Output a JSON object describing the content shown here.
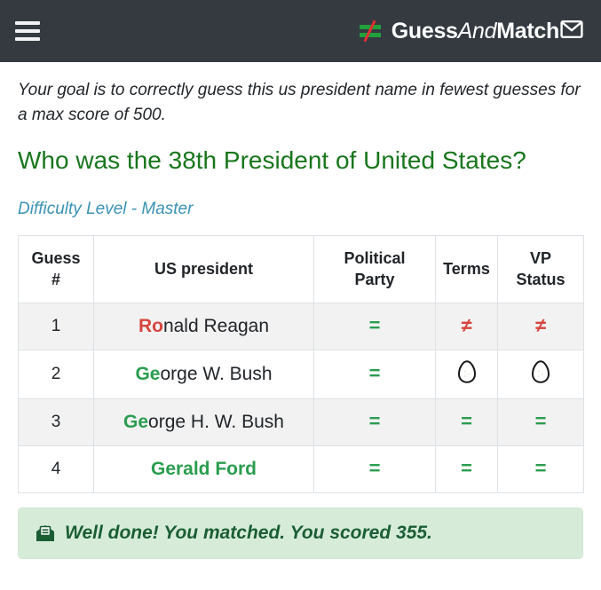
{
  "navbar": {
    "menu_icon": "hamburger-icon",
    "brand": {
      "logo_icon": "not-equals-logo-icon",
      "part1": "Guess",
      "part2": "And",
      "part3": "Match",
      "mail_icon": "envelope-icon"
    }
  },
  "intro": {
    "goal": "Your goal is to correctly guess this us president name in fewest guesses for a max score of 500.",
    "question": "Who was the 38th President of United States?",
    "difficulty": "Difficulty Level - Master"
  },
  "table": {
    "headers": {
      "guess": "Guess #",
      "guess_line1": "Guess",
      "guess_line2": "#",
      "president": "US president",
      "party_line1": "Political",
      "party_line2": "Party",
      "terms": "Terms",
      "vp_line1": "VP",
      "vp_line2": "Status"
    },
    "rows": [
      {
        "guess_no": "1",
        "name_hint": "Ro",
        "name_rest": "nald Reagan",
        "hint_state": "red",
        "party": "=",
        "terms": "≠",
        "vp": "≠",
        "party_state": "match",
        "terms_state": "no-match",
        "vp_state": "no-match",
        "full_match": false
      },
      {
        "guess_no": "2",
        "name_hint": "Ge",
        "name_rest": "orge W. Bush",
        "hint_state": "green",
        "party": "=",
        "terms": "egg",
        "vp": "egg",
        "party_state": "match",
        "terms_state": "egg",
        "vp_state": "egg",
        "full_match": false
      },
      {
        "guess_no": "3",
        "name_hint": "Ge",
        "name_rest": "orge H. W. Bush",
        "hint_state": "green",
        "party": "=",
        "terms": "=",
        "vp": "=",
        "party_state": "match",
        "terms_state": "match",
        "vp_state": "match",
        "full_match": false
      },
      {
        "guess_no": "4",
        "name_hint": "Gerald Ford",
        "name_rest": "",
        "hint_state": "full",
        "party": "=",
        "terms": "=",
        "vp": "=",
        "party_state": "match",
        "terms_state": "match",
        "vp_state": "match",
        "full_match": true
      }
    ]
  },
  "result": {
    "icon": "mail-open-icon",
    "message": "Well done! You matched. You scored 355."
  },
  "colors": {
    "navbar_bg": "#343a40",
    "match_green": "#2a9d4f",
    "no_match_red": "#d6453f",
    "question_green": "#19761d",
    "difficulty_blue": "#3b93b5",
    "banner_bg": "#d6ecd9",
    "banner_text": "#1b5e34"
  }
}
